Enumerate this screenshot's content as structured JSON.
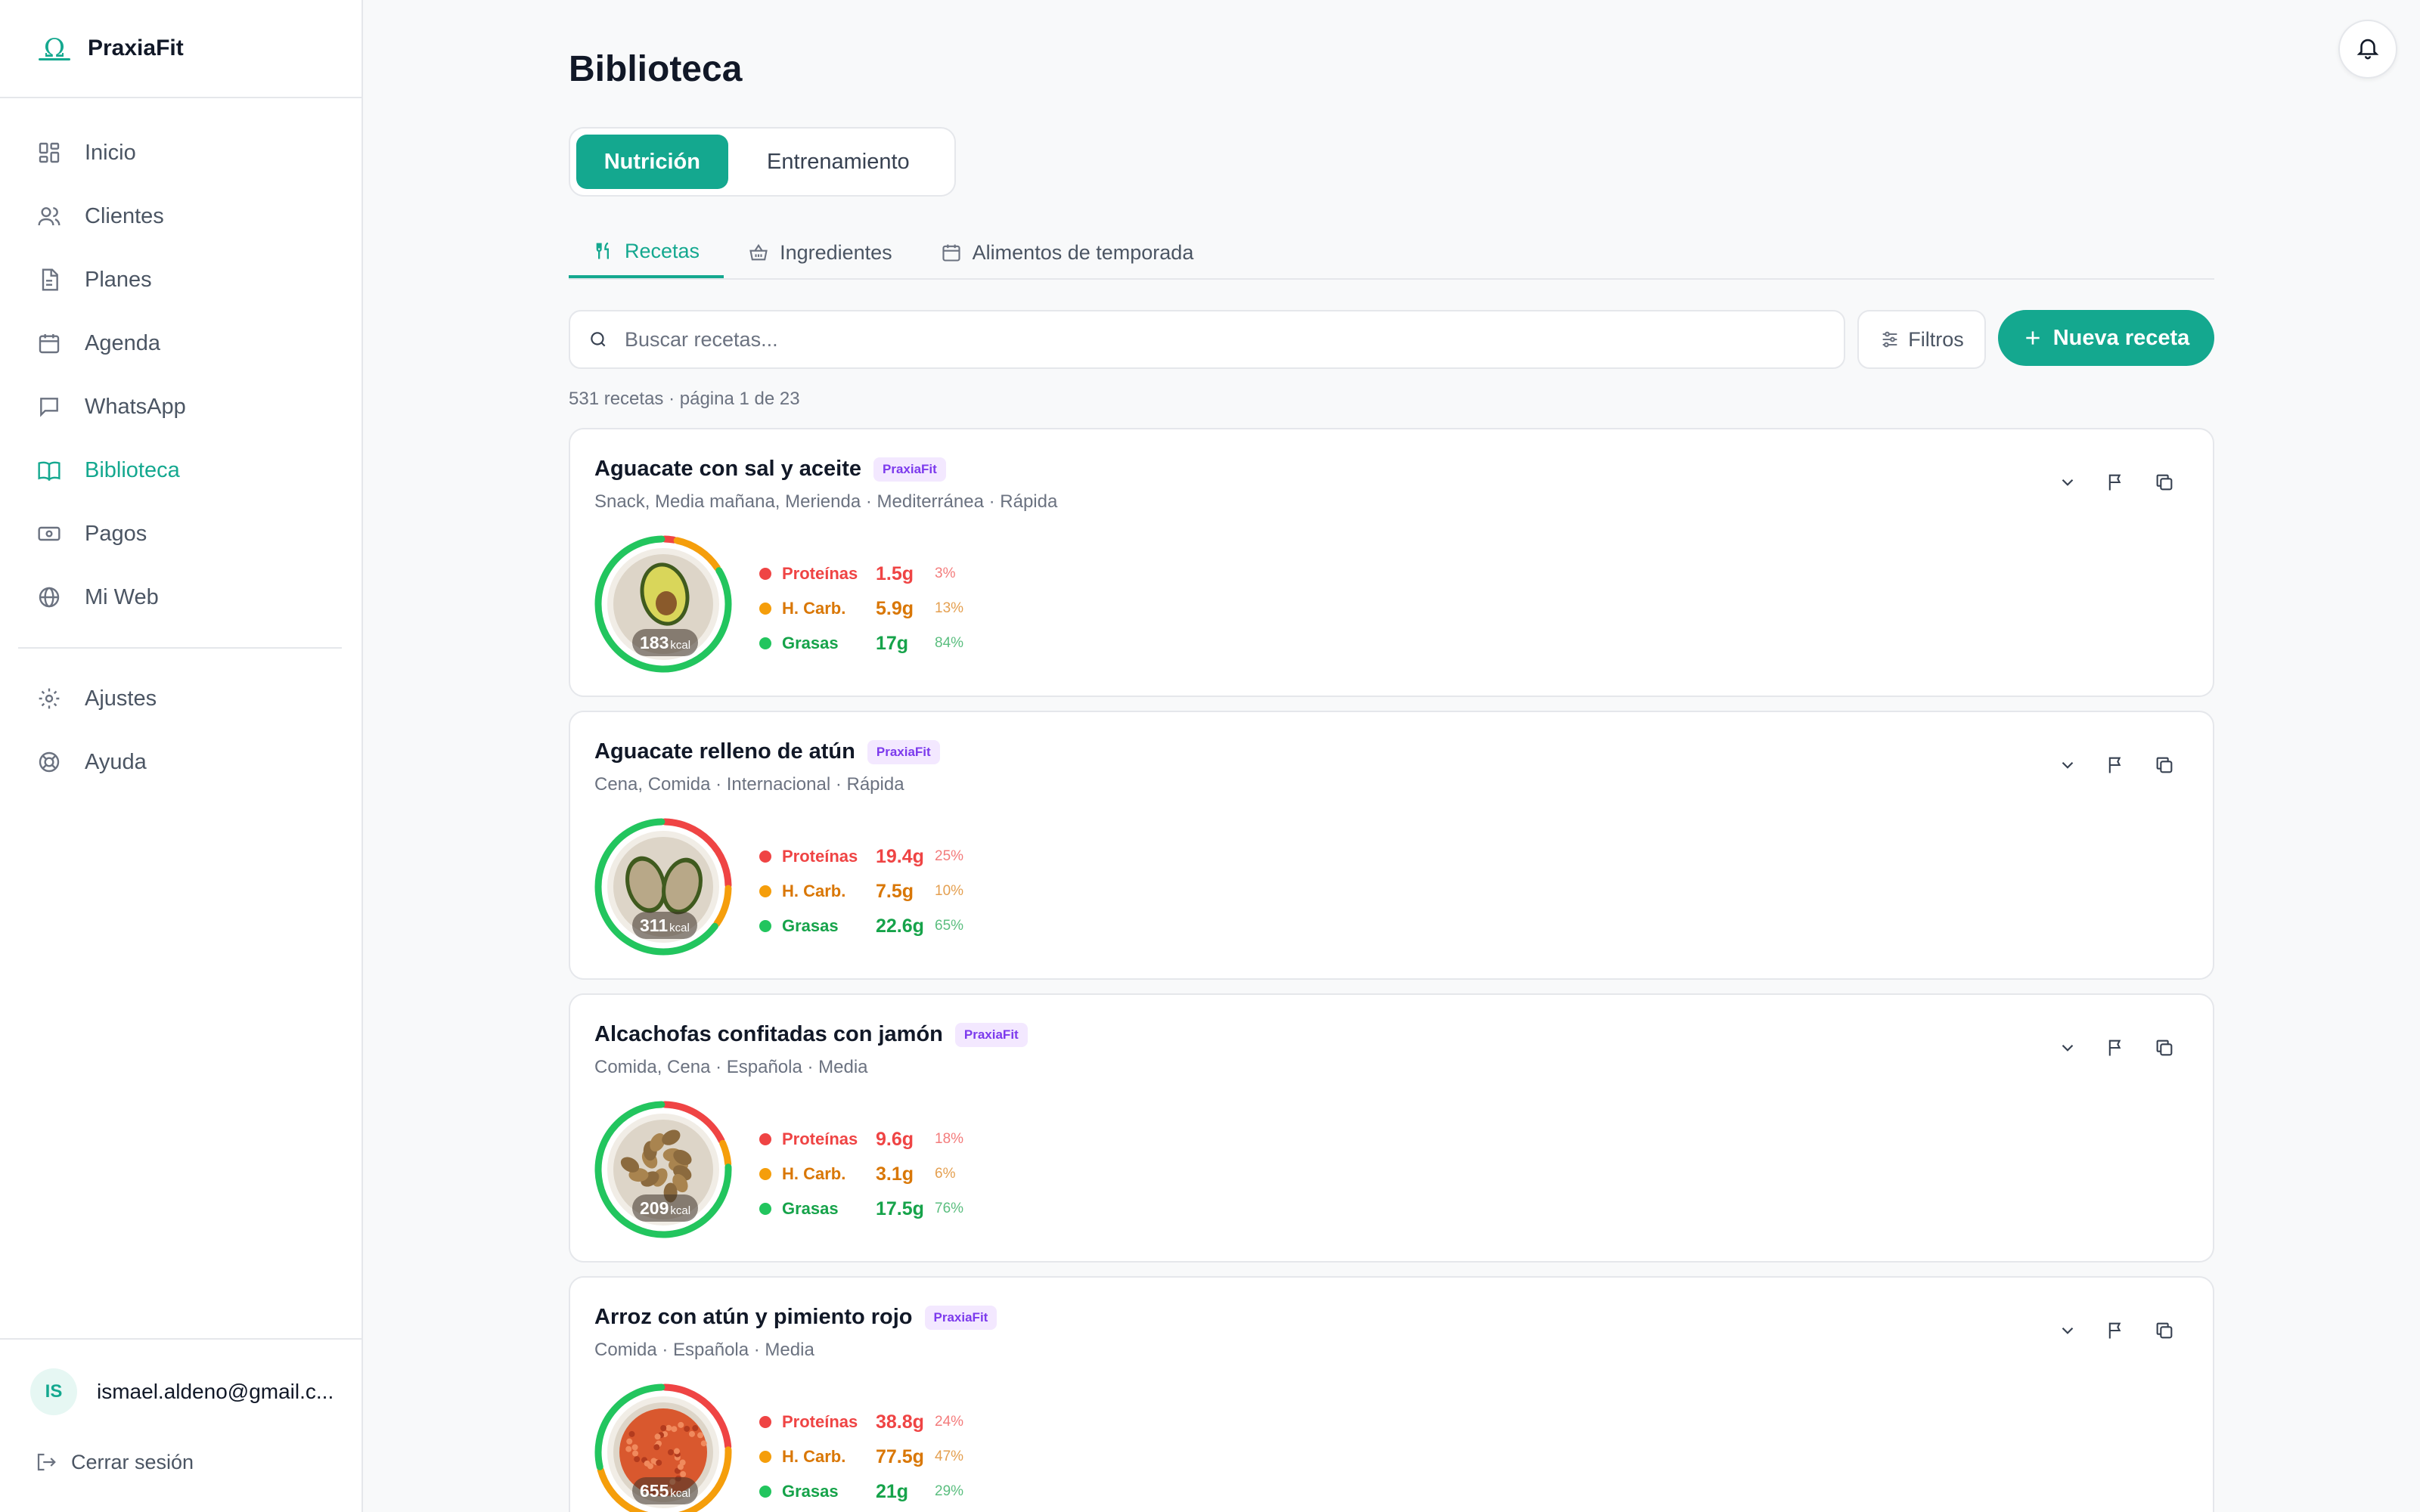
{
  "app": {
    "name": "PraxiaFit"
  },
  "colors": {
    "accent": "#14a88f",
    "protein": "#ef4444",
    "carbs": "#f59e0b",
    "fat": "#22c55e",
    "badge": "#7c3aed"
  },
  "sidebar": {
    "items": [
      {
        "label": "Inicio",
        "icon": "grid-icon"
      },
      {
        "label": "Clientes",
        "icon": "users-icon"
      },
      {
        "label": "Planes",
        "icon": "document-icon"
      },
      {
        "label": "Agenda",
        "icon": "calendar-icon"
      },
      {
        "label": "WhatsApp",
        "icon": "chat-icon"
      },
      {
        "label": "Biblioteca",
        "icon": "book-icon",
        "active": true
      },
      {
        "label": "Pagos",
        "icon": "money-icon"
      },
      {
        "label": "Mi Web",
        "icon": "globe-icon"
      }
    ],
    "secondary": [
      {
        "label": "Ajustes",
        "icon": "gear-icon"
      },
      {
        "label": "Ayuda",
        "icon": "lifebuoy-icon"
      }
    ],
    "user": {
      "initials": "IS",
      "email": "ismael.aldeno@gmail.c..."
    },
    "logout_label": "Cerrar sesión"
  },
  "page": {
    "title": "Biblioteca",
    "segments": [
      "Nutrición",
      "Entrenamiento"
    ],
    "subtabs": [
      "Recetas",
      "Ingredientes",
      "Alimentos de temporada"
    ],
    "search_placeholder": "Buscar recetas...",
    "filter_label": "Filtros",
    "new_label": "Nueva receta",
    "count_text": "531 recetas · página 1 de 23"
  },
  "macro_labels": {
    "protein": "Proteínas",
    "carbs": "H. Carb.",
    "fat": "Grasas"
  },
  "recipes": [
    {
      "name": "Aguacate con sal y aceite",
      "badge": "PraxiaFit",
      "meta": "Snack, Media mañana, Merienda · Mediterránea · Rápida",
      "kcal": "183",
      "kcal_unit": "kcal",
      "protein": "1.5g",
      "protein_pct": "3%",
      "carbs": "5.9g",
      "carbs_pct": "13%",
      "fat": "17g",
      "fat_pct": "84%",
      "shares": [
        3,
        13,
        84
      ],
      "food": "avocado"
    },
    {
      "name": "Aguacate relleno de atún",
      "badge": "PraxiaFit",
      "meta": "Cena, Comida · Internacional · Rápida",
      "kcal": "311",
      "kcal_unit": "kcal",
      "protein": "19.4g",
      "protein_pct": "25%",
      "carbs": "7.5g",
      "carbs_pct": "10%",
      "fat": "22.6g",
      "fat_pct": "65%",
      "shares": [
        25,
        10,
        65
      ],
      "food": "stuffed"
    },
    {
      "name": "Alcachofas confitadas con jamón",
      "badge": "PraxiaFit",
      "meta": "Comida, Cena · Española · Media",
      "kcal": "209",
      "kcal_unit": "kcal",
      "protein": "9.6g",
      "protein_pct": "18%",
      "carbs": "3.1g",
      "carbs_pct": "6%",
      "fat": "17.5g",
      "fat_pct": "76%",
      "shares": [
        18,
        6,
        76
      ],
      "food": "artichoke"
    },
    {
      "name": "Arroz con atún y pimiento rojo",
      "badge": "PraxiaFit",
      "meta": "Comida · Española · Media",
      "kcal": "655",
      "kcal_unit": "kcal",
      "protein": "38.8g",
      "protein_pct": "24%",
      "carbs": "77.5g",
      "carbs_pct": "47%",
      "fat": "21g",
      "fat_pct": "29%",
      "shares": [
        24,
        47,
        29
      ],
      "food": "rice"
    }
  ]
}
